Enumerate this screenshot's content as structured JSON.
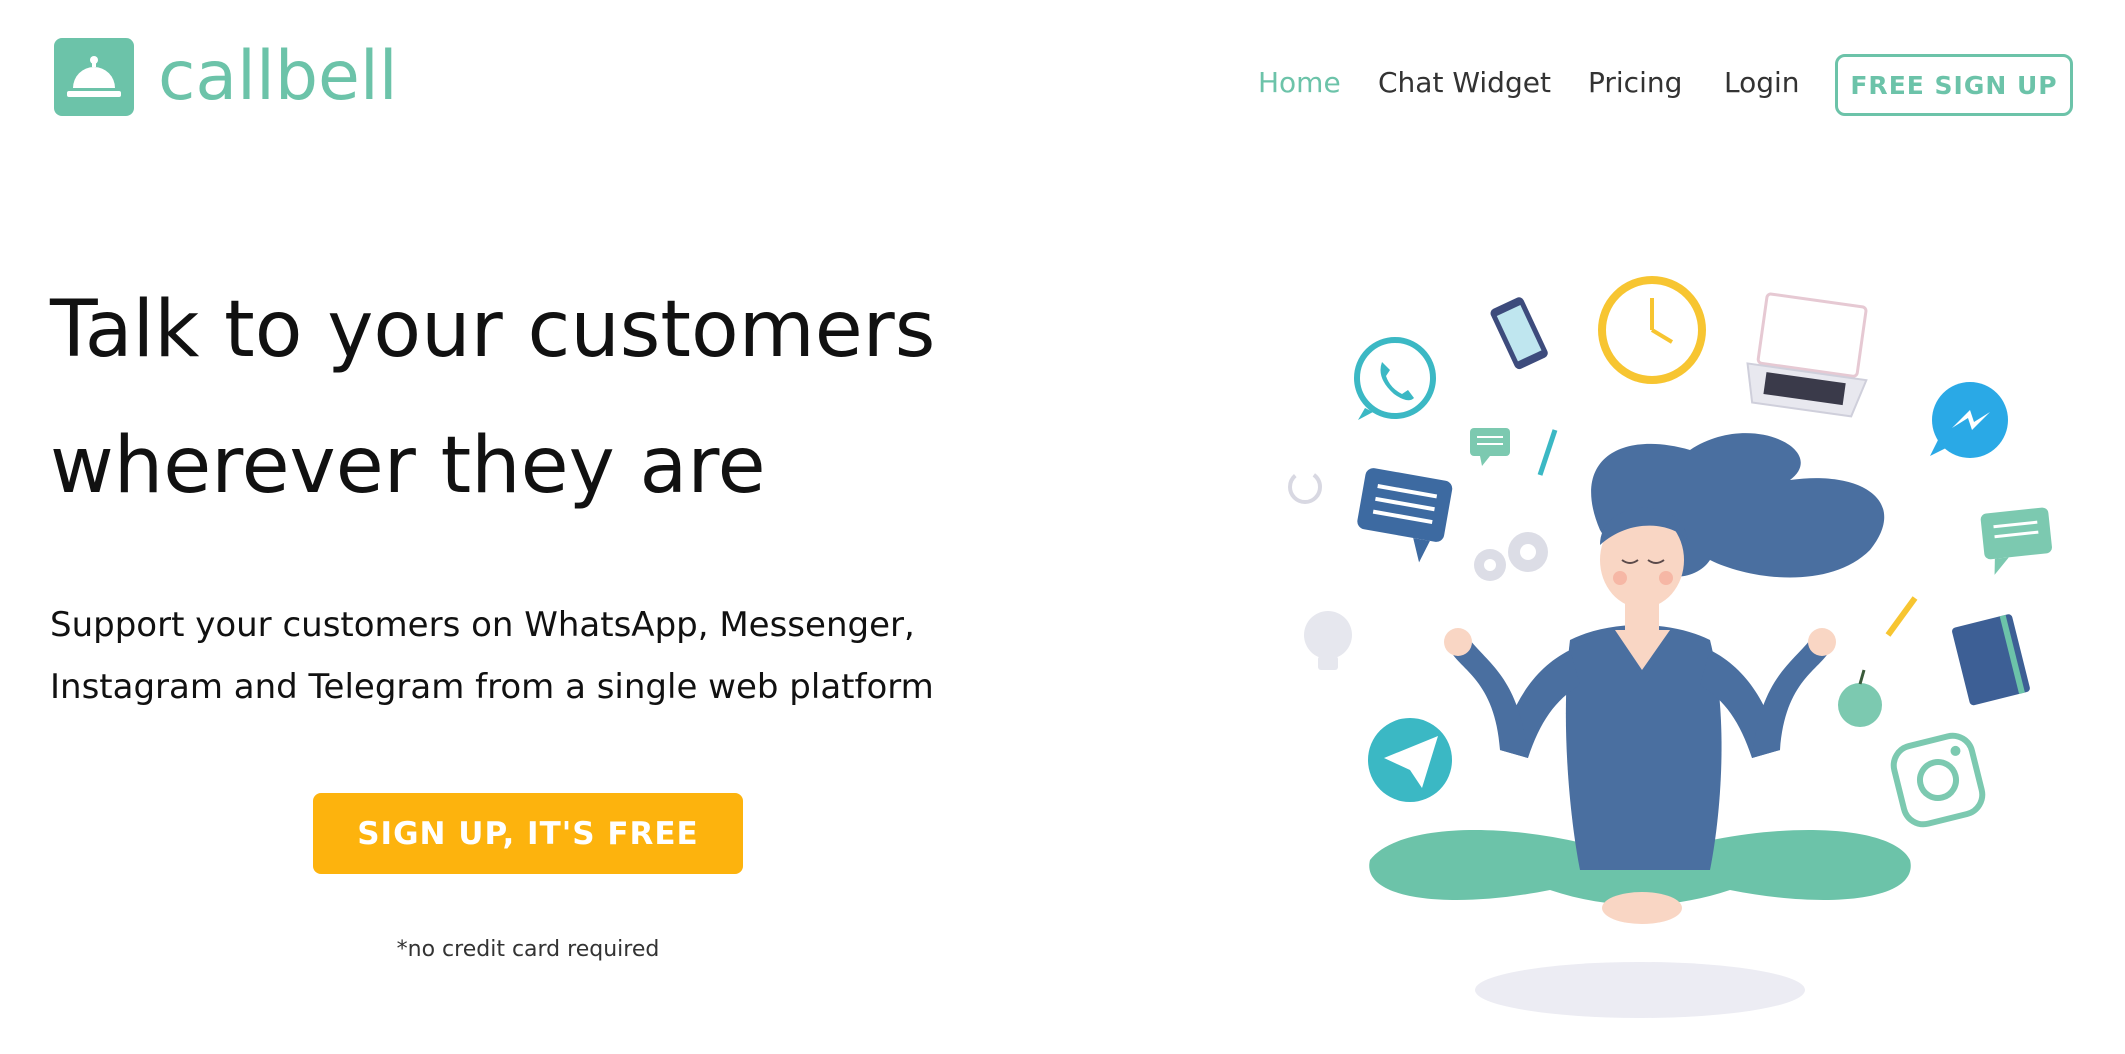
{
  "brand": {
    "name": "callbell",
    "color": "#6cc3a9"
  },
  "nav": {
    "items": [
      {
        "label": "Home",
        "active": true
      },
      {
        "label": "Chat Widget",
        "active": false
      },
      {
        "label": "Pricing",
        "active": false
      },
      {
        "label": "Login",
        "active": false
      }
    ],
    "cta_label": "FREE SIGN UP"
  },
  "hero": {
    "headline_line1": "Talk to your customers",
    "headline_line2": "wherever they are",
    "sub_line1": "Support your customers on WhatsApp, Messenger,",
    "sub_line2": "Instagram and Telegram from a single web platform",
    "cta_label": "SIGN UP, IT'S FREE",
    "cta_color": "#fdb30d",
    "note": "*no credit card required"
  },
  "illustration": {
    "subject": "meditating-woman",
    "icons": [
      "whatsapp-icon",
      "phone-icon",
      "clock-icon",
      "laptop-icon",
      "messenger-icon",
      "chat-bubble-icon",
      "pencil-icon",
      "gear-icon",
      "lightbulb-icon",
      "notebook-icon",
      "apple-icon",
      "telegram-icon",
      "instagram-icon"
    ]
  }
}
